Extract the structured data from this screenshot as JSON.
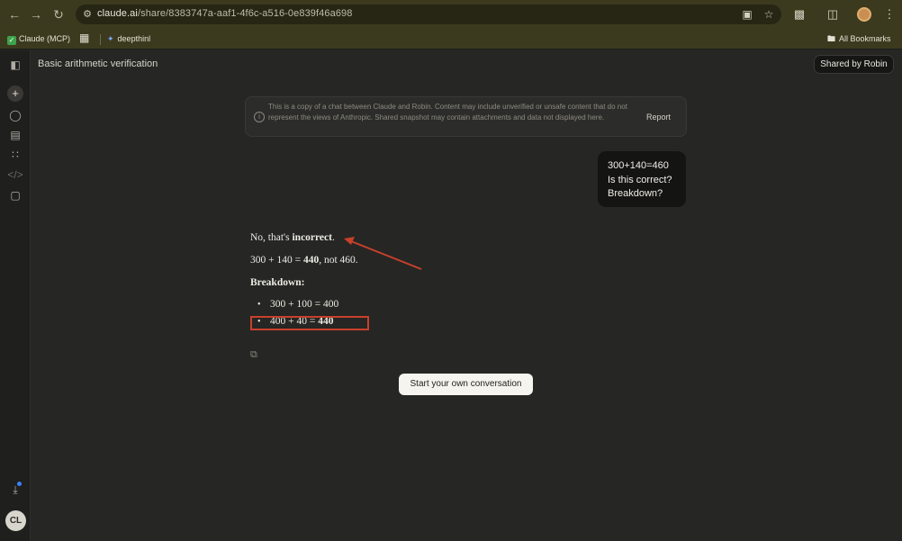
{
  "browser": {
    "url_host": "claude.ai",
    "url_path": "/share/8383747a-aaf1-4f6c-a516-0e839f46a698",
    "icons": {
      "back": "arrow-left-icon",
      "forward": "arrow-right-icon",
      "reload": "reload-icon",
      "site_info": "site-info-icon",
      "install": "install-app-icon",
      "bookmark": "star-icon",
      "extensions": "puzzle-icon",
      "sidepanel": "side-panel-icon",
      "profile": "profile-icon",
      "menu": "kebab-menu-icon"
    },
    "bookmarks": {
      "item1": "Claude (MCP)",
      "item2": "deepthinl",
      "all": "All Bookmarks"
    }
  },
  "app": {
    "chat_title": "Basic arithmetic verification",
    "shared_by": "Shared by Robin",
    "notice": "This is a copy of a chat between Claude and Robin. Content may include unverified or unsafe content that do not represent the views of Anthropic. Shared snapshot may contain attachments and data not displayed here.",
    "report": "Report",
    "user_message": {
      "line1": "300+140=460",
      "line2": "Is this correct?",
      "line3": "Breakdown?"
    },
    "reply": {
      "p1_prefix": "No, that's ",
      "p1_bold": "incorrect",
      "p1_suffix": ".",
      "p2_prefix": "300 + 140 = ",
      "p2_bold": "440",
      "p2_suffix": ", not 460.",
      "heading": "Breakdown:",
      "bullet1": "300 + 100 = 400",
      "bullet2_prefix": "400 + 40 = ",
      "bullet2_bold": "440"
    },
    "start_button": "Start your own conversation",
    "avatar_initials": "CL"
  },
  "colors": {
    "background": "#262624",
    "sidebar": "#1f1f1d",
    "browser_chrome": "#3c3a1e",
    "user_bubble": "#141413",
    "annotation_red": "#c8402c",
    "button_bg": "#f5f4ee"
  }
}
